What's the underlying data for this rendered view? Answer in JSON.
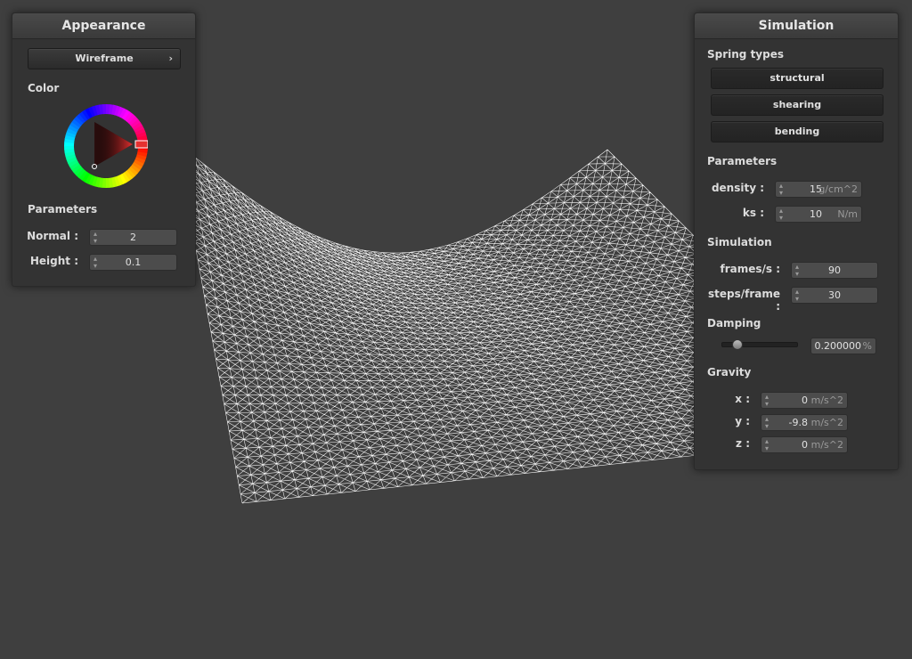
{
  "appearance": {
    "title": "Appearance",
    "render_mode": "Wireframe",
    "color_label": "Color",
    "color_value": "#e53030",
    "params_label": "Parameters",
    "normal_label": "Normal :",
    "normal_value": "2",
    "height_label": "Height :",
    "height_value": "0.1"
  },
  "simulation": {
    "title": "Simulation",
    "spring_types_label": "Spring types",
    "spring_types": [
      "structural",
      "shearing",
      "bending"
    ],
    "params_label": "Parameters",
    "density_label": "density :",
    "density_value": "15",
    "density_unit": "g/cm^2",
    "ks_label": "ks :",
    "ks_value": "10",
    "ks_unit": "N/m",
    "sim_label": "Simulation",
    "fps_label": "frames/s :",
    "fps_value": "90",
    "steps_label": "steps/frame :",
    "steps_value": "30",
    "damping_label": "Damping",
    "damping_value": "0.200000",
    "damping_unit": "%",
    "damping_fraction": 0.2,
    "gravity_label": "Gravity",
    "gx_label": "x :",
    "gx_value": "0",
    "gy_label": "y :",
    "gy_value": "-9.8",
    "gz_label": "z :",
    "gz_value": "0",
    "gravity_unit": "m/s^2"
  },
  "colors": {
    "background": "#3f3f3f",
    "panel": "#333333",
    "mesh": "#ffffff"
  }
}
